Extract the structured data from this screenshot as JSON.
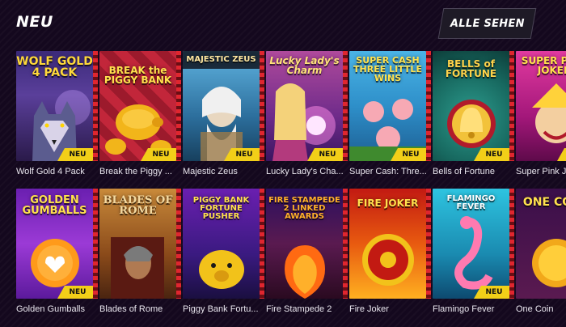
{
  "section": {
    "title": "NEU",
    "see_all_label": "ALLE SEHEN"
  },
  "badge_label": "NEU",
  "rows": [
    [
      {
        "name": "Wolf Gold 4 Pack",
        "logo": "WOLF GOLD 4 PACK",
        "new": true
      },
      {
        "name": "Break the Piggy ...",
        "logo": "BREAK the PIGGY BANK",
        "new": true
      },
      {
        "name": "Majestic Zeus",
        "logo": "MAJESTIC ZEUS",
        "new": true
      },
      {
        "name": "Lucky Lady's Cha...",
        "logo": "Lucky Lady's Charm",
        "new": true
      },
      {
        "name": "Super Cash: Thre...",
        "logo": "SUPER CASH THREE LITTLE WINS",
        "new": true
      },
      {
        "name": "Bells of Fortune",
        "logo": "BELLS of FORTUNE",
        "new": true
      },
      {
        "name": "Super Pink Jo",
        "logo": "SUPER PINK JOKER",
        "new": true
      }
    ],
    [
      {
        "name": "Golden Gumballs",
        "logo": "GOLDEN GUMBALLS",
        "new": true
      },
      {
        "name": "Blades of Rome",
        "logo": "BLADES OF ROME",
        "new": false
      },
      {
        "name": "Piggy Bank Fortu...",
        "logo": "PIGGY BANK FORTUNE PUSHER",
        "new": false
      },
      {
        "name": "Fire Stampede 2",
        "logo": "FIRE STAMPEDE 2 LINKED AWARDS",
        "new": false
      },
      {
        "name": "Fire Joker",
        "logo": "FIRE JOKER",
        "new": false
      },
      {
        "name": "Flamingo Fever",
        "logo": "FLAMINGO FEVER",
        "new": true
      },
      {
        "name": "One Coin",
        "logo": "ONE COIN",
        "new": false
      }
    ]
  ]
}
